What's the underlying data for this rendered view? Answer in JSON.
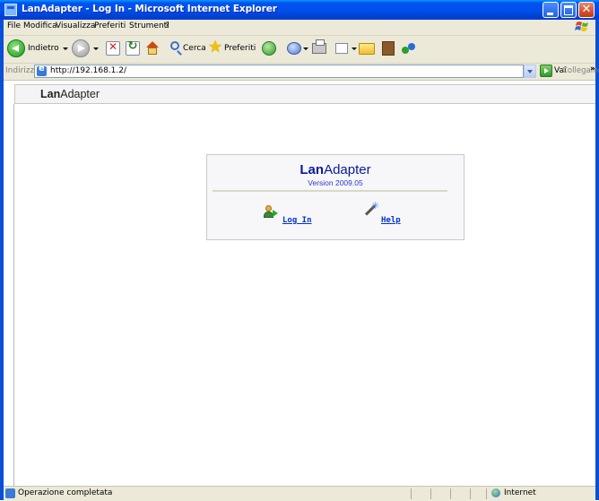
{
  "window": {
    "title": "LanAdapter - Log In - Microsoft Internet Explorer",
    "close_symbol": "✕"
  },
  "menu": {
    "items": [
      "File",
      "Modifica",
      "Visualizza",
      "Preferiti",
      "Strumenti",
      "?"
    ]
  },
  "toolbar": {
    "back_label": "Indietro",
    "search_label": "Cerca",
    "favorites_label": "Preferiti"
  },
  "address": {
    "label": "Indirizzo",
    "url": "http://192.168.1.2/",
    "go_label": "Vai",
    "links_label": "Collegamenti",
    "links_chevron": "»"
  },
  "page": {
    "banner_brand_bold": "Lan",
    "banner_brand_rest": "Adapter",
    "logo_bold": "Lan",
    "logo_rest": "Adapter",
    "version": "Version  2009.05",
    "login_link": "Log In",
    "help_link": "Help"
  },
  "status": {
    "text": "Operazione completata",
    "zone": "Internet"
  },
  "colors": {
    "titlebar": "#0053ee",
    "link": "#0033cc",
    "logo": "#0a1a9a"
  }
}
